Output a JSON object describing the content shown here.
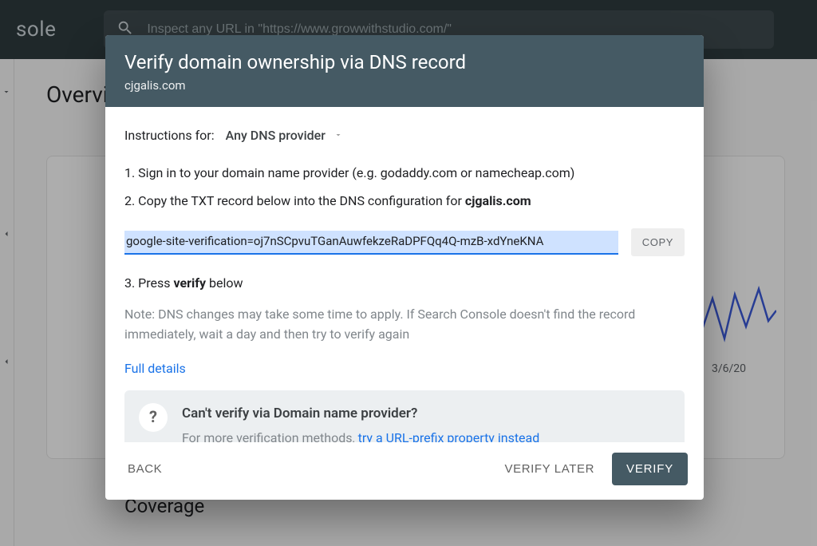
{
  "header": {
    "brand_fragment": "sole",
    "search_placeholder": "Inspect any URL in \"https://www.growwithstudio.com/\""
  },
  "background": {
    "page_title": "Overview",
    "coverage_title": "Coverage",
    "date_label": "3/6/20"
  },
  "modal": {
    "title": "Verify domain ownership via DNS record",
    "domain": "cjgalis.com",
    "instructions_label": "Instructions for:",
    "provider_selected": "Any DNS provider",
    "step1": "1. Sign in to your domain name provider (e.g. godaddy.com or namecheap.com)",
    "step2_prefix": "2. Copy the TXT record below into the DNS configuration for ",
    "step2_bold": "cjgalis.com",
    "txt_record": "google-site-verification=oj7nSCpvuTGanAuwfekzeRaDPFQq4Q-mzB-xdYneKNA",
    "copy_label": "COPY",
    "step3_prefix": "3. Press ",
    "step3_bold": "verify",
    "step3_suffix": " below",
    "note": "Note: DNS changes may take some time to apply. If Search Console doesn't find the record immediately, wait a day and then try to verify again",
    "full_details": "Full details",
    "help_title": "Can't verify via Domain name provider?",
    "help_text_prefix": "For more verification methods, ",
    "help_link": "try a URL-prefix property instead",
    "back_label": "BACK",
    "later_label": "VERIFY LATER",
    "verify_label": "VERIFY"
  }
}
